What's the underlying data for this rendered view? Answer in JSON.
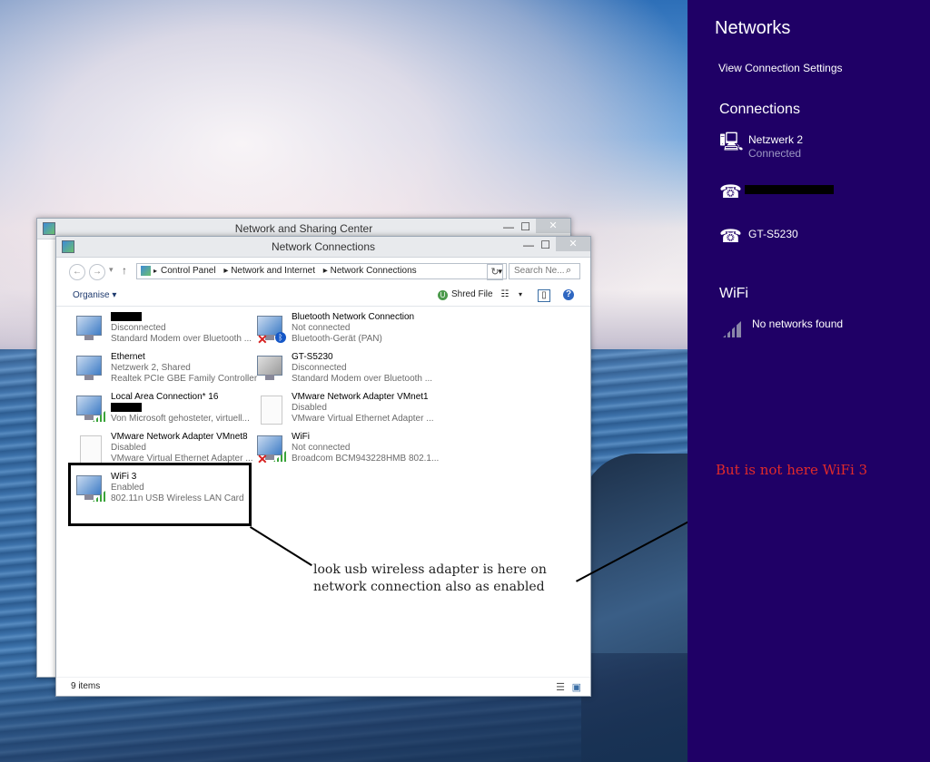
{
  "charms": {
    "title": "Networks",
    "view_settings": "View Connection Settings",
    "connections_header": "Connections",
    "connections": [
      {
        "name": "Netzwerk  2",
        "status": "Connected",
        "icon": "wired-network-icon"
      },
      {
        "name": "",
        "status": "",
        "icon": "phone-icon",
        "redacted": true
      },
      {
        "name": "GT-S5230",
        "status": "",
        "icon": "phone-icon"
      }
    ],
    "wifi_header": "WiFi",
    "wifi_empty": "No networks found"
  },
  "sharing_window": {
    "title": "Network and Sharing Center"
  },
  "conn_window": {
    "title": "Network Connections",
    "breadcrumb": [
      "Control Panel",
      "Network and Internet",
      "Network Connections"
    ],
    "search_placeholder": "Search Ne...",
    "organise_label": "Organise ▾",
    "shred_label": "Shred File",
    "status_count": "9 items",
    "items": [
      {
        "name": "",
        "redacted": true,
        "status": "Disconnected",
        "device": "Standard Modem over Bluetooth ...",
        "icon": "network-monitor-icon"
      },
      {
        "name": "Bluetooth Network Connection",
        "status": "Not connected",
        "device": "Bluetooth-Gerät (PAN)",
        "icon": "bluetooth-icon"
      },
      {
        "name": "Ethernet",
        "status": "Netzwerk  2, Shared",
        "device": "Realtek PCIe GBE Family Controller",
        "icon": "network-monitor-icon"
      },
      {
        "name": "GT-S5230",
        "status": "Disconnected",
        "device": "Standard Modem over Bluetooth ...",
        "icon": "network-monitor-icon"
      },
      {
        "name": "Local Area Connection* 16",
        "status": "",
        "redacted_status": true,
        "device": "Von Microsoft gehosteter, virtuell...",
        "icon": "wifi-signal-icon"
      },
      {
        "name": "VMware Network Adapter VMnet1",
        "status": "Disabled",
        "device": "VMware Virtual Ethernet Adapter ...",
        "icon": "document-icon"
      },
      {
        "name": "VMware Network Adapter VMnet8",
        "status": "Disabled",
        "device": "VMware Virtual Ethernet Adapter ...",
        "icon": "document-icon"
      },
      {
        "name": "WiFi",
        "status": "Not connected",
        "device": "Broadcom BCM943228HMB 802.1...",
        "icon": "wifi-disconnected-icon"
      },
      {
        "name": "WiFi 3",
        "status": "Enabled",
        "device": "802.11n USB Wireless LAN Card",
        "icon": "wifi-signal-icon"
      }
    ]
  },
  "annotations": {
    "note_line1": "look usb wireless adapter is here on",
    "note_line2": "network connection also as enabled",
    "red_note": "But is not here WiFi 3",
    "red_color": "#e12a2a"
  }
}
